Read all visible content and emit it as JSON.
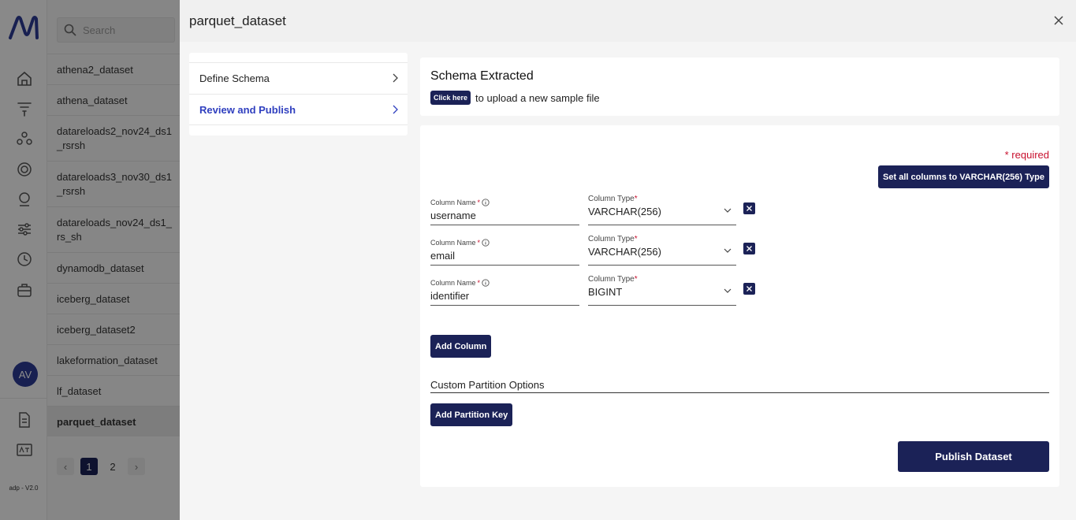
{
  "app": {
    "version": "adp - V2.0",
    "avatar_initials": "AV",
    "brand_color": "#1b2257",
    "search_placeholder": "Search"
  },
  "datasets": [
    {
      "label": "athena2_dataset",
      "lines": 1
    },
    {
      "label": "athena_dataset",
      "lines": 1
    },
    {
      "label": "datareloads2_nov24_ds1_rsrsh",
      "lines": 2
    },
    {
      "label": "datareloads3_nov30_ds1_rsrsh",
      "lines": 2
    },
    {
      "label": "datareloads_nov24_ds1_rs_sh",
      "lines": 2
    },
    {
      "label": "dynamodb_dataset",
      "lines": 1
    },
    {
      "label": "iceberg_dataset",
      "lines": 1
    },
    {
      "label": "iceberg_dataset2",
      "lines": 1
    },
    {
      "label": "lakeformation_dataset",
      "lines": 1
    },
    {
      "label": "lf_dataset",
      "lines": 1
    },
    {
      "label": "parquet_dataset",
      "lines": 1,
      "active": true
    }
  ],
  "pagination": {
    "pages": [
      "1",
      "2"
    ],
    "current": "1"
  },
  "drawer": {
    "title": "parquet_dataset",
    "steps": [
      {
        "label": "Define Schema",
        "active": false
      },
      {
        "label": "Review and Publish",
        "active": true
      }
    ],
    "schema_card": {
      "heading": "Schema Extracted",
      "click_here": "Click here",
      "upload_text": "to upload a new sample file"
    },
    "form": {
      "required_note": "* required",
      "set_all_button": "Set all columns to VARCHAR(256) Type",
      "column_name_label": "Column Name",
      "column_type_label": "Column Type",
      "required_star": "*",
      "columns": [
        {
          "name": "username",
          "type": "VARCHAR(256)"
        },
        {
          "name": "email",
          "type": "VARCHAR(256)"
        },
        {
          "name": "identifier",
          "type": "BIGINT"
        }
      ],
      "add_column_button": "Add Column",
      "partition_title": "Custom Partition Options",
      "add_partition_button": "Add Partition Key",
      "publish_button": "Publish Dataset"
    }
  }
}
